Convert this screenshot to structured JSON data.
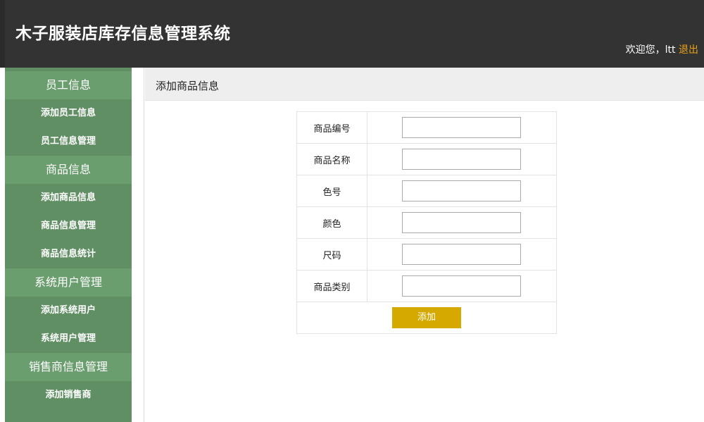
{
  "header": {
    "title": "木子服装店库存信息管理系统",
    "welcome": "欢迎您，ltt ",
    "logout": "退出"
  },
  "sidebar": {
    "groups": [
      {
        "label": "员工信息",
        "items": [
          "添加员工信息",
          "员工信息管理"
        ]
      },
      {
        "label": "商品信息",
        "items": [
          "添加商品信息",
          "商品信息管理",
          "商品信息统计"
        ]
      },
      {
        "label": "系统用户管理",
        "items": [
          "添加系统用户",
          "系统用户管理"
        ]
      },
      {
        "label": "销售商信息管理",
        "items": [
          "添加销售商"
        ]
      }
    ]
  },
  "main": {
    "title": "添加商品信息",
    "form": {
      "fields": [
        {
          "label": "商品编号",
          "value": ""
        },
        {
          "label": "商品名称",
          "value": ""
        },
        {
          "label": "色号",
          "value": ""
        },
        {
          "label": "颜色",
          "value": ""
        },
        {
          "label": "尺码",
          "value": ""
        },
        {
          "label": "商品类别",
          "value": ""
        }
      ],
      "submit_label": "添加"
    }
  },
  "colors": {
    "header_bg": "#333333",
    "sidebar_bg": "#5f8f63",
    "sidebar_group_bg": "#6b9e6e",
    "logout_link": "#e8a317",
    "submit_bg": "#d5a900"
  }
}
